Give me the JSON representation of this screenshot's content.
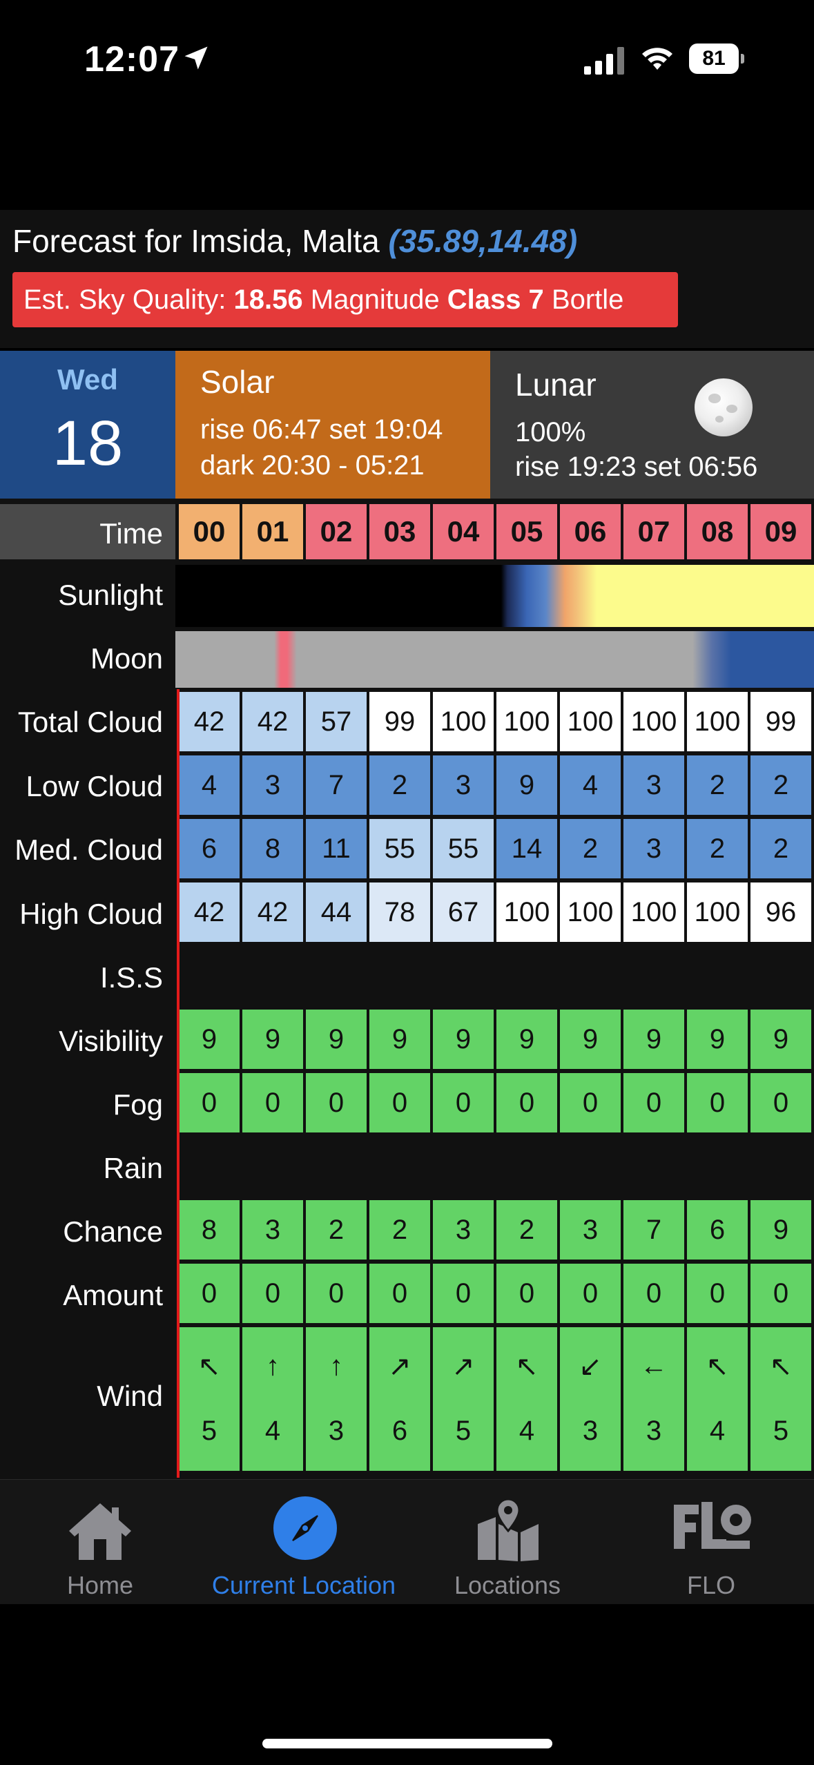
{
  "status_bar": {
    "time": "12:07",
    "battery": "81",
    "icons": [
      "location-arrow-icon",
      "cell-signal-icon",
      "wifi-icon",
      "battery-icon"
    ]
  },
  "header": {
    "title": "Forecast for Imsida, Malta",
    "coords": "(35.89,14.48)",
    "sky_quality": {
      "prefix": "Est. Sky Quality:",
      "value": "18.56",
      "magnitude": "Magnitude",
      "class": "Class 7",
      "bortle": "Bortle"
    }
  },
  "day": {
    "weekday": "Wed",
    "date": "18"
  },
  "solar": {
    "heading": "Solar",
    "line1": "rise 06:47 set 19:04",
    "line2": "dark 20:30 - 05:21"
  },
  "lunar": {
    "heading": "Lunar",
    "illumination": "100%",
    "line2": "rise 19:23 set 06:56"
  },
  "grid": {
    "row_labels": [
      "Time",
      "Sunlight",
      "Moon",
      "Total Cloud",
      "Low Cloud",
      "Med. Cloud",
      "High Cloud",
      "I.S.S",
      "Visibility",
      "Fog",
      "Rain",
      "Chance",
      "Amount",
      "Wind"
    ],
    "hours": [
      "00",
      "01",
      "02",
      "03",
      "04",
      "05",
      "06",
      "07",
      "08",
      "09"
    ],
    "hour_colors": [
      "#f2b070",
      "#f2b070",
      "#ee6f7f",
      "#ee6f7f",
      "#ee6f7f",
      "#ee6f7f",
      "#ee6f7f",
      "#ee6f7f",
      "#ee6f7f",
      "#ee6f7f"
    ],
    "total_cloud": [
      "42",
      "42",
      "57",
      "99",
      "100",
      "100",
      "100",
      "100",
      "100",
      "99"
    ],
    "low_cloud": [
      "4",
      "3",
      "7",
      "2",
      "3",
      "9",
      "4",
      "3",
      "2",
      "2"
    ],
    "med_cloud": [
      "6",
      "8",
      "11",
      "55",
      "55",
      "14",
      "2",
      "3",
      "2",
      "2"
    ],
    "high_cloud": [
      "42",
      "42",
      "44",
      "78",
      "67",
      "100",
      "100",
      "100",
      "100",
      "96"
    ],
    "visibility": [
      "9",
      "9",
      "9",
      "9",
      "9",
      "9",
      "9",
      "9",
      "9",
      "9"
    ],
    "fog": [
      "0",
      "0",
      "0",
      "0",
      "0",
      "0",
      "0",
      "0",
      "0",
      "0"
    ],
    "chance": [
      "8",
      "3",
      "2",
      "2",
      "3",
      "2",
      "3",
      "7",
      "6",
      "9"
    ],
    "amount": [
      "0",
      "0",
      "0",
      "0",
      "0",
      "0",
      "0",
      "0",
      "0",
      "0"
    ],
    "wind_arrows": [
      "↖",
      "↑",
      "↑",
      "↗",
      "↗",
      "↖",
      "↙",
      "←",
      "↖",
      "↖"
    ],
    "wind_speed": [
      "5",
      "4",
      "3",
      "6",
      "5",
      "4",
      "3",
      "3",
      "4",
      "5"
    ]
  },
  "colors": {
    "cloud_light": "#b8d3ef",
    "cloud_mid": "#5f93d3",
    "cloud_pale": "#dce8f6",
    "cloud_white": "#ffffff",
    "green": "#63d366"
  },
  "tabs": [
    {
      "label": "Home",
      "icon": "house-icon"
    },
    {
      "label": "Current Location",
      "icon": "compass-icon",
      "active": true
    },
    {
      "label": "Locations",
      "icon": "map-pin-icon"
    },
    {
      "label": "FLO",
      "icon": "flo-logo-icon"
    }
  ]
}
